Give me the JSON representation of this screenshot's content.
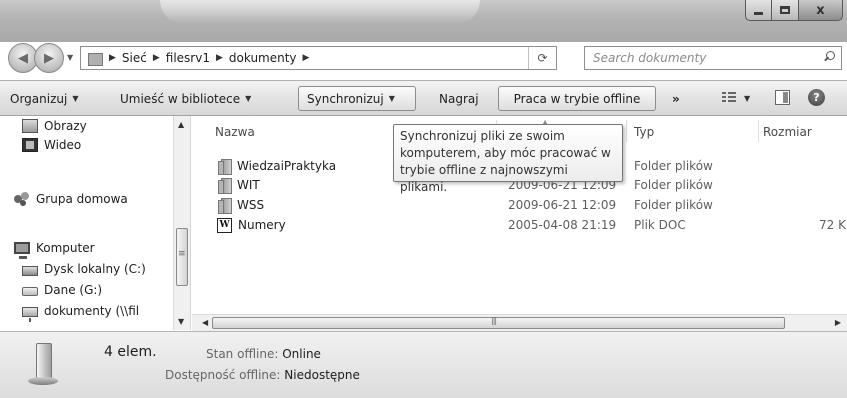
{
  "window": {
    "controls": {
      "minimize": "",
      "maximize": "",
      "close": "x"
    }
  },
  "address": {
    "crumbs": [
      "Sieć",
      "filesrv1",
      "dokumenty"
    ],
    "search_placeholder": "Search dokumenty"
  },
  "toolbar": {
    "organize": "Organizuj",
    "include_in_library": "Umieść w bibliotece",
    "sync": "Synchronizuj",
    "burn": "Nagraj",
    "work_offline": "Praca w trybie offline",
    "more": "»"
  },
  "navpane": {
    "items": [
      {
        "label": "Obrazy",
        "icon": "pictures-icon"
      },
      {
        "label": "Wideo",
        "icon": "video-icon"
      },
      {
        "label": "Grupa domowa",
        "icon": "homegroup-icon"
      },
      {
        "label": "Komputer",
        "icon": "computer-icon"
      },
      {
        "label": "Dysk lokalny (C:)",
        "icon": "disk-icon"
      },
      {
        "label": "Dane (G:)",
        "icon": "drive-icon"
      },
      {
        "label": "dokumenty (\\\\fil",
        "icon": "network-drive-icon"
      }
    ]
  },
  "columns": {
    "name": "Nazwa",
    "type": "Typ",
    "size": "Rozmiar"
  },
  "files": [
    {
      "name": "WiedzaiPraktyka",
      "date": "",
      "type": "Folder plików",
      "size": "",
      "icon": "folder-icon"
    },
    {
      "name": "WIT",
      "date": "2009-06-21 12:09",
      "type": "Folder plików",
      "size": "",
      "icon": "folder-icon"
    },
    {
      "name": "WSS",
      "date": "2009-06-21 12:09",
      "type": "Folder plików",
      "size": "",
      "icon": "folder-icon"
    },
    {
      "name": "Numery",
      "date": "2005-04-08 21:19",
      "type": "Plik DOC",
      "size": "72 K",
      "icon": "word-doc-icon"
    }
  ],
  "tooltip": {
    "lines": [
      "Synchronizuj pliki ze swoim",
      "komputerem, aby móc pracować w",
      "trybie offline z najnowszymi plikami."
    ]
  },
  "details": {
    "count": "4 elem.",
    "status_label": "Stan offline:",
    "status_value": "Online",
    "availability_label": "Dostępność offline:",
    "availability_value": "Niedostępne"
  }
}
